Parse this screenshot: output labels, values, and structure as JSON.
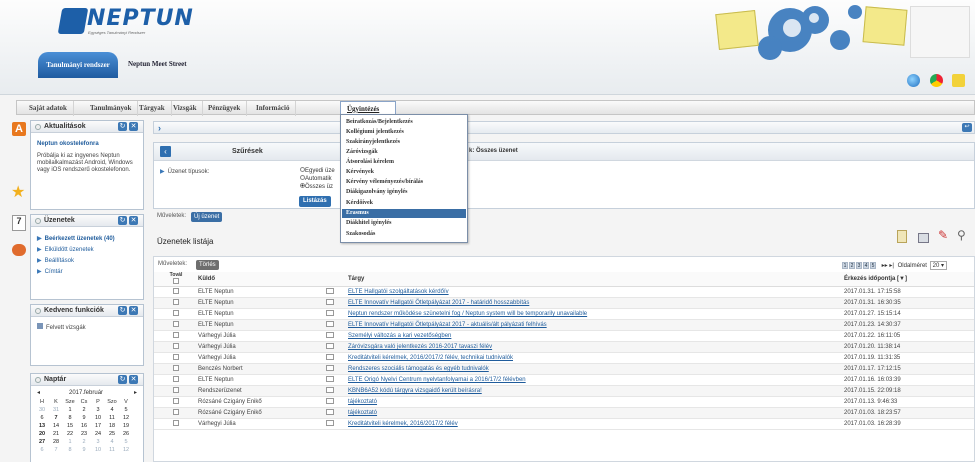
{
  "header": {
    "logo_text": "NEPTUN",
    "logo_subtitle": "Egységes Tanulmányi Rendszer",
    "module_tab": "Tanulmányi rendszer",
    "meet_street": "Neptun Meet Street"
  },
  "menu": {
    "items": [
      "Saját adatok",
      "Tanulmányok",
      "Tárgyak",
      "Vizsgák",
      "Pénzügyek",
      "Információ",
      "Ügyintézés"
    ],
    "dropdown": [
      "Beiratkozás/Bejelentkezés",
      "Kollégiumi jelentkezés",
      "Szakirányjelentkezés",
      "Záróvizsgák",
      "Átsorolási kérelem",
      "Kérvények",
      "Kérvény véleményezés/bírálás",
      "Diákigazolvány igénylés",
      "Kérdőívek",
      "Erasmus",
      "Diákhitel igénylés",
      "Szakosodás"
    ],
    "dropdown_selected": 9
  },
  "sidebar": {
    "news": {
      "title": "Aktualitások",
      "heading": "Neptun okostelefonra",
      "body": "Próbálja ki az ingyenes Neptun mobilalkalmazást Android, Windows vagy iOS rendszerű okostelefonon."
    },
    "messages": {
      "title": "Üzenetek",
      "items": [
        "Beérkezett üzenetek (40)",
        "Elküldött üzenetek",
        "Beállítások",
        "Címtár"
      ]
    },
    "favorites": {
      "title": "Kedvenc funkciók",
      "items": [
        "Felvett vizsgák"
      ]
    },
    "calendar": {
      "title": "Naptár",
      "month": "2017.február",
      "weekdays": [
        "H",
        "K",
        "Sze",
        "Cs",
        "P",
        "Szo",
        "V"
      ],
      "weeks": [
        [
          "30",
          "31",
          "1",
          "2",
          "3",
          "4",
          "5"
        ],
        [
          "6",
          "7",
          "8",
          "9",
          "10",
          "11",
          "12"
        ],
        [
          "13",
          "14",
          "15",
          "16",
          "17",
          "18",
          "19"
        ],
        [
          "20",
          "21",
          "22",
          "23",
          "24",
          "25",
          "26"
        ],
        [
          "27",
          "28",
          "1",
          "2",
          "3",
          "4",
          "5"
        ],
        [
          "6",
          "7",
          "8",
          "9",
          "10",
          "11",
          "12"
        ]
      ],
      "other_month": [
        [
          0,
          0
        ],
        [
          0,
          1
        ],
        [
          4,
          2
        ],
        [
          4,
          3
        ],
        [
          4,
          4
        ],
        [
          4,
          5
        ],
        [
          4,
          6
        ],
        [
          5,
          0
        ],
        [
          5,
          1
        ],
        [
          5,
          2
        ],
        [
          5,
          3
        ],
        [
          5,
          4
        ],
        [
          5,
          5
        ],
        [
          5,
          6
        ]
      ]
    }
  },
  "filter": {
    "title": "Szűrések",
    "right_label": "k: Összes üzenet",
    "type_label": "Üzenet típusok:",
    "options": [
      "Egyedi üze",
      "Automatik",
      "Összes üz"
    ],
    "selected_option": 2,
    "list_button": "Listázás"
  },
  "actions": {
    "label": "Műveletek:",
    "new_message": "Új üzenet",
    "delete": "Törlés"
  },
  "messages_list": {
    "title": "Üzenetek listája",
    "columns": {
      "select": "Továl",
      "sender": "Küldő",
      "subject": "Tárgy",
      "date": "Érkezés időpontja"
    },
    "sort_indicator": "[▼]",
    "pages": [
      "1",
      "2",
      "3",
      "4",
      "5"
    ],
    "pager_controls": "▸▸ ▸|",
    "page_size_label": "Oldalméret",
    "page_size": "20",
    "rows": [
      {
        "sender": "ELTE Neptun",
        "subject": "ELTE Hallgatói szolgáltatások kérdőív",
        "date": "2017.01.31. 17:15:58"
      },
      {
        "sender": "ELTE Neptun",
        "subject": "ELTE Innovatív Hallgatói Ötletpályázat 2017 - határidő hosszabbítás",
        "date": "2017.01.31. 16:30:35"
      },
      {
        "sender": "ELTE Neptun",
        "subject": "Neptun rendszer működése szünetelni fog / Neptun system will be temporarily unavailable",
        "date": "2017.01.27. 15:15:14"
      },
      {
        "sender": "ELTE Neptun",
        "subject": "ELTE Innovatív Hallgatói Ötletpályázat 2017 - aktuális/ált pályázati felhívás",
        "date": "2017.01.23. 14:30:37"
      },
      {
        "sender": "Várhegyi Júlia",
        "subject": "Személyi változás a kari vezetőségben",
        "date": "2017.01.22. 16:11:05"
      },
      {
        "sender": "Várhegyi Júlia",
        "subject": "Záróvizsgára való jelentkezés 2016-2017 tavaszi félév",
        "date": "2017.01.20. 11:38:14"
      },
      {
        "sender": "Várhegyi Júlia",
        "subject": "Kreditátviteli kérelmek, 2016/2017/2 félév, technikai tudnivalók",
        "date": "2017.01.19. 11:31:35"
      },
      {
        "sender": "Benczés Norbert",
        "subject": "Rendszeres szociális támogatás és egyéb tudnivalók",
        "date": "2017.01.17. 17:12:15"
      },
      {
        "sender": "ELTE Neptun",
        "subject": "ELTE Origó Nyelvi Centrum nyelvtanfolyamai a 2016/17/2 félévben",
        "date": "2017.01.16. 16:03:39"
      },
      {
        "sender": "Rendszerüzenet",
        "subject": "KBNB6A52 kódú tárgyra vizsgaidő került beírásra!",
        "date": "2017.01.15. 22:09:18"
      },
      {
        "sender": "Rózsáné Czigány Enikő",
        "subject": "tájékoztató",
        "date": "2017.01.13. 9:46:33"
      },
      {
        "sender": "Rózsáné Czigány Enikő",
        "subject": "tájékoztató",
        "date": "2017.01.03. 18:23:57"
      },
      {
        "sender": "Várhegyi Júlia",
        "subject": "Kreditátviteli kérelmek, 2016/2017/2 félév",
        "date": "2017.01.03. 16:28:39"
      }
    ]
  }
}
